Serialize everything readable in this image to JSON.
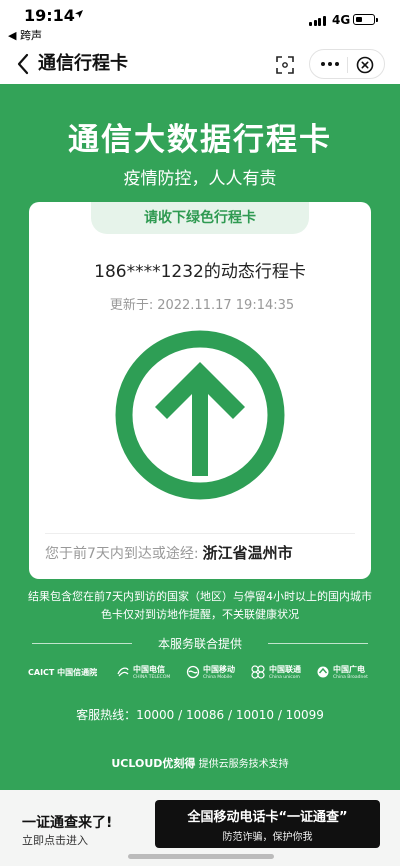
{
  "status_bar": {
    "time": "19:14",
    "network": "4G",
    "back_app": "◀ 跨声"
  },
  "nav": {
    "title": "通信行程卡"
  },
  "main": {
    "title": "通信大数据行程卡",
    "subtitle": "疫情防控，人人有责",
    "card": {
      "tab_label": "请收下绿色行程卡",
      "phone_line": "186****1232的动态行程卡",
      "updated_label": "更新于:",
      "updated_time": "2022.11.17 19:14:35",
      "route_label": "您于前7天内到达或途经:",
      "route_city": "浙江省温州市",
      "status_color": "#2e9e55"
    },
    "note_line1": "结果包含您在前7天内到访的国家（地区）与停留4小时以上的国内城市",
    "note_line2": "色卡仅对到访地作提醒，不关联健康状况",
    "joint_label": "本服务联合提供",
    "logos": [
      {
        "name": "CAICT 中国信通院"
      },
      {
        "name": "中国电信",
        "sub": "CHINA TELECOM"
      },
      {
        "name": "中国移动",
        "sub": "China Mobile"
      },
      {
        "name": "中国联通",
        "sub": "China unicom"
      },
      {
        "name": "中国广电",
        "sub": "China Broadnet"
      }
    ],
    "hotline": "客服热线：10000 / 10086 / 10010 / 10099",
    "support_brand": "UCLOUD优刻得",
    "support_text": "提供云服务技术支持"
  },
  "banner": {
    "title": "一证通查来了!",
    "subtitle": "立即点击进入",
    "ad_title": "全国移动电话卡“一证通查”",
    "ad_subtitle": "防范诈骗，保护你我"
  },
  "colors": {
    "green": "#33a358",
    "accent_green": "#2e9e55"
  }
}
